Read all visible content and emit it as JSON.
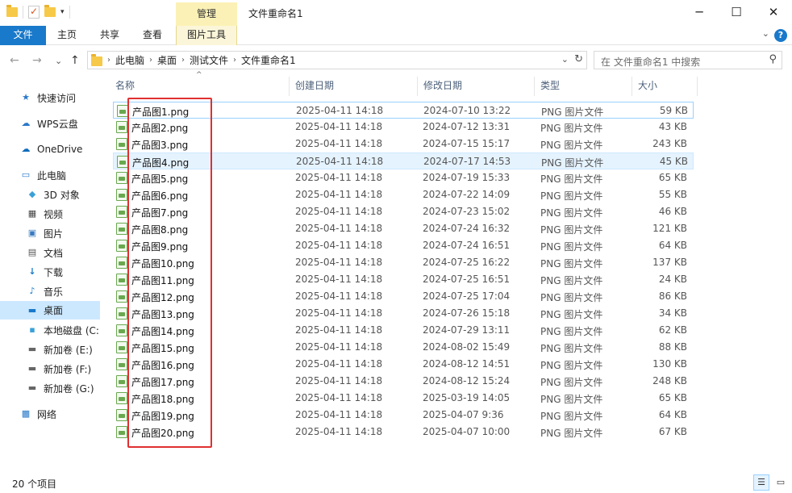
{
  "window": {
    "title": "文件重命名1",
    "contextual_tab": "管理",
    "minimize": "─",
    "maximize": "☐",
    "close": "✕"
  },
  "ribbon": {
    "tabs": [
      "文件",
      "主页",
      "共享",
      "查看",
      "图片工具"
    ],
    "help": "?",
    "collapse": "⌄"
  },
  "nav": {
    "back": "←",
    "forward": "→",
    "recent": "⌄",
    "up": "↑",
    "breadcrumbs": [
      "此电脑",
      "桌面",
      "测试文件",
      "文件重命名1"
    ],
    "dropdown": "⌄",
    "refresh": "↻"
  },
  "search": {
    "placeholder": "在 文件重命名1 中搜索",
    "icon": "search-icon"
  },
  "sidebar": {
    "items": [
      {
        "label": "快速访问",
        "icon": "star-icon"
      },
      {
        "label": "WPS云盘",
        "icon": "cloud-icon"
      },
      {
        "label": "OneDrive",
        "icon": "onedrive-icon"
      },
      {
        "label": "此电脑",
        "icon": "computer-icon"
      },
      {
        "label": "3D 对象",
        "icon": "cube-icon"
      },
      {
        "label": "视频",
        "icon": "video-icon"
      },
      {
        "label": "图片",
        "icon": "picture-icon"
      },
      {
        "label": "文档",
        "icon": "document-icon"
      },
      {
        "label": "下载",
        "icon": "download-icon"
      },
      {
        "label": "音乐",
        "icon": "music-icon"
      },
      {
        "label": "桌面",
        "icon": "desktop-icon"
      },
      {
        "label": "本地磁盘 (C:",
        "icon": "drive-icon"
      },
      {
        "label": "新加卷 (E:)",
        "icon": "drive-icon"
      },
      {
        "label": "新加卷 (F:)",
        "icon": "drive-icon"
      },
      {
        "label": "新加卷 (G:)",
        "icon": "drive-icon"
      },
      {
        "label": "网络",
        "icon": "network-icon"
      }
    ]
  },
  "columns": [
    "名称",
    "创建日期",
    "修改日期",
    "类型",
    "大小"
  ],
  "files": [
    {
      "name": "产品图1.png",
      "created": "2025-04-11 14:18",
      "modified": "2024-07-10 13:22",
      "type": "PNG 图片文件",
      "size": "59 KB"
    },
    {
      "name": "产品图2.png",
      "created": "2025-04-11 14:18",
      "modified": "2024-07-12 13:31",
      "type": "PNG 图片文件",
      "size": "43 KB"
    },
    {
      "name": "产品图3.png",
      "created": "2025-04-11 14:18",
      "modified": "2024-07-15 15:17",
      "type": "PNG 图片文件",
      "size": "243 KB"
    },
    {
      "name": "产品图4.png",
      "created": "2025-04-11 14:18",
      "modified": "2024-07-17 14:53",
      "type": "PNG 图片文件",
      "size": "45 KB"
    },
    {
      "name": "产品图5.png",
      "created": "2025-04-11 14:18",
      "modified": "2024-07-19 15:33",
      "type": "PNG 图片文件",
      "size": "65 KB"
    },
    {
      "name": "产品图6.png",
      "created": "2025-04-11 14:18",
      "modified": "2024-07-22 14:09",
      "type": "PNG 图片文件",
      "size": "55 KB"
    },
    {
      "name": "产品图7.png",
      "created": "2025-04-11 14:18",
      "modified": "2024-07-23 15:02",
      "type": "PNG 图片文件",
      "size": "46 KB"
    },
    {
      "name": "产品图8.png",
      "created": "2025-04-11 14:18",
      "modified": "2024-07-24 16:32",
      "type": "PNG 图片文件",
      "size": "121 KB"
    },
    {
      "name": "产品图9.png",
      "created": "2025-04-11 14:18",
      "modified": "2024-07-24 16:51",
      "type": "PNG 图片文件",
      "size": "64 KB"
    },
    {
      "name": "产品图10.png",
      "created": "2025-04-11 14:18",
      "modified": "2024-07-25 16:22",
      "type": "PNG 图片文件",
      "size": "137 KB"
    },
    {
      "name": "产品图11.png",
      "created": "2025-04-11 14:18",
      "modified": "2024-07-25 16:51",
      "type": "PNG 图片文件",
      "size": "24 KB"
    },
    {
      "name": "产品图12.png",
      "created": "2025-04-11 14:18",
      "modified": "2024-07-25 17:04",
      "type": "PNG 图片文件",
      "size": "86 KB"
    },
    {
      "name": "产品图13.png",
      "created": "2025-04-11 14:18",
      "modified": "2024-07-26 15:18",
      "type": "PNG 图片文件",
      "size": "34 KB"
    },
    {
      "name": "产品图14.png",
      "created": "2025-04-11 14:18",
      "modified": "2024-07-29 13:11",
      "type": "PNG 图片文件",
      "size": "62 KB"
    },
    {
      "name": "产品图15.png",
      "created": "2025-04-11 14:18",
      "modified": "2024-08-02 15:49",
      "type": "PNG 图片文件",
      "size": "88 KB"
    },
    {
      "name": "产品图16.png",
      "created": "2025-04-11 14:18",
      "modified": "2024-08-12 14:51",
      "type": "PNG 图片文件",
      "size": "130 KB"
    },
    {
      "name": "产品图17.png",
      "created": "2025-04-11 14:18",
      "modified": "2024-08-12 15:24",
      "type": "PNG 图片文件",
      "size": "248 KB"
    },
    {
      "name": "产品图18.png",
      "created": "2025-04-11 14:18",
      "modified": "2025-03-19 14:05",
      "type": "PNG 图片文件",
      "size": "65 KB"
    },
    {
      "name": "产品图19.png",
      "created": "2025-04-11 14:18",
      "modified": "2025-04-07 9:36",
      "type": "PNG 图片文件",
      "size": "64 KB"
    },
    {
      "name": "产品图20.png",
      "created": "2025-04-11 14:18",
      "modified": "2025-04-07 10:00",
      "type": "PNG 图片文件",
      "size": "67 KB"
    }
  ],
  "selected_index": 3,
  "status": {
    "count": "20 个项目"
  },
  "colors": {
    "accent": "#1979ca",
    "highlight_box": "#e03030",
    "selection": "#cce8ff"
  }
}
